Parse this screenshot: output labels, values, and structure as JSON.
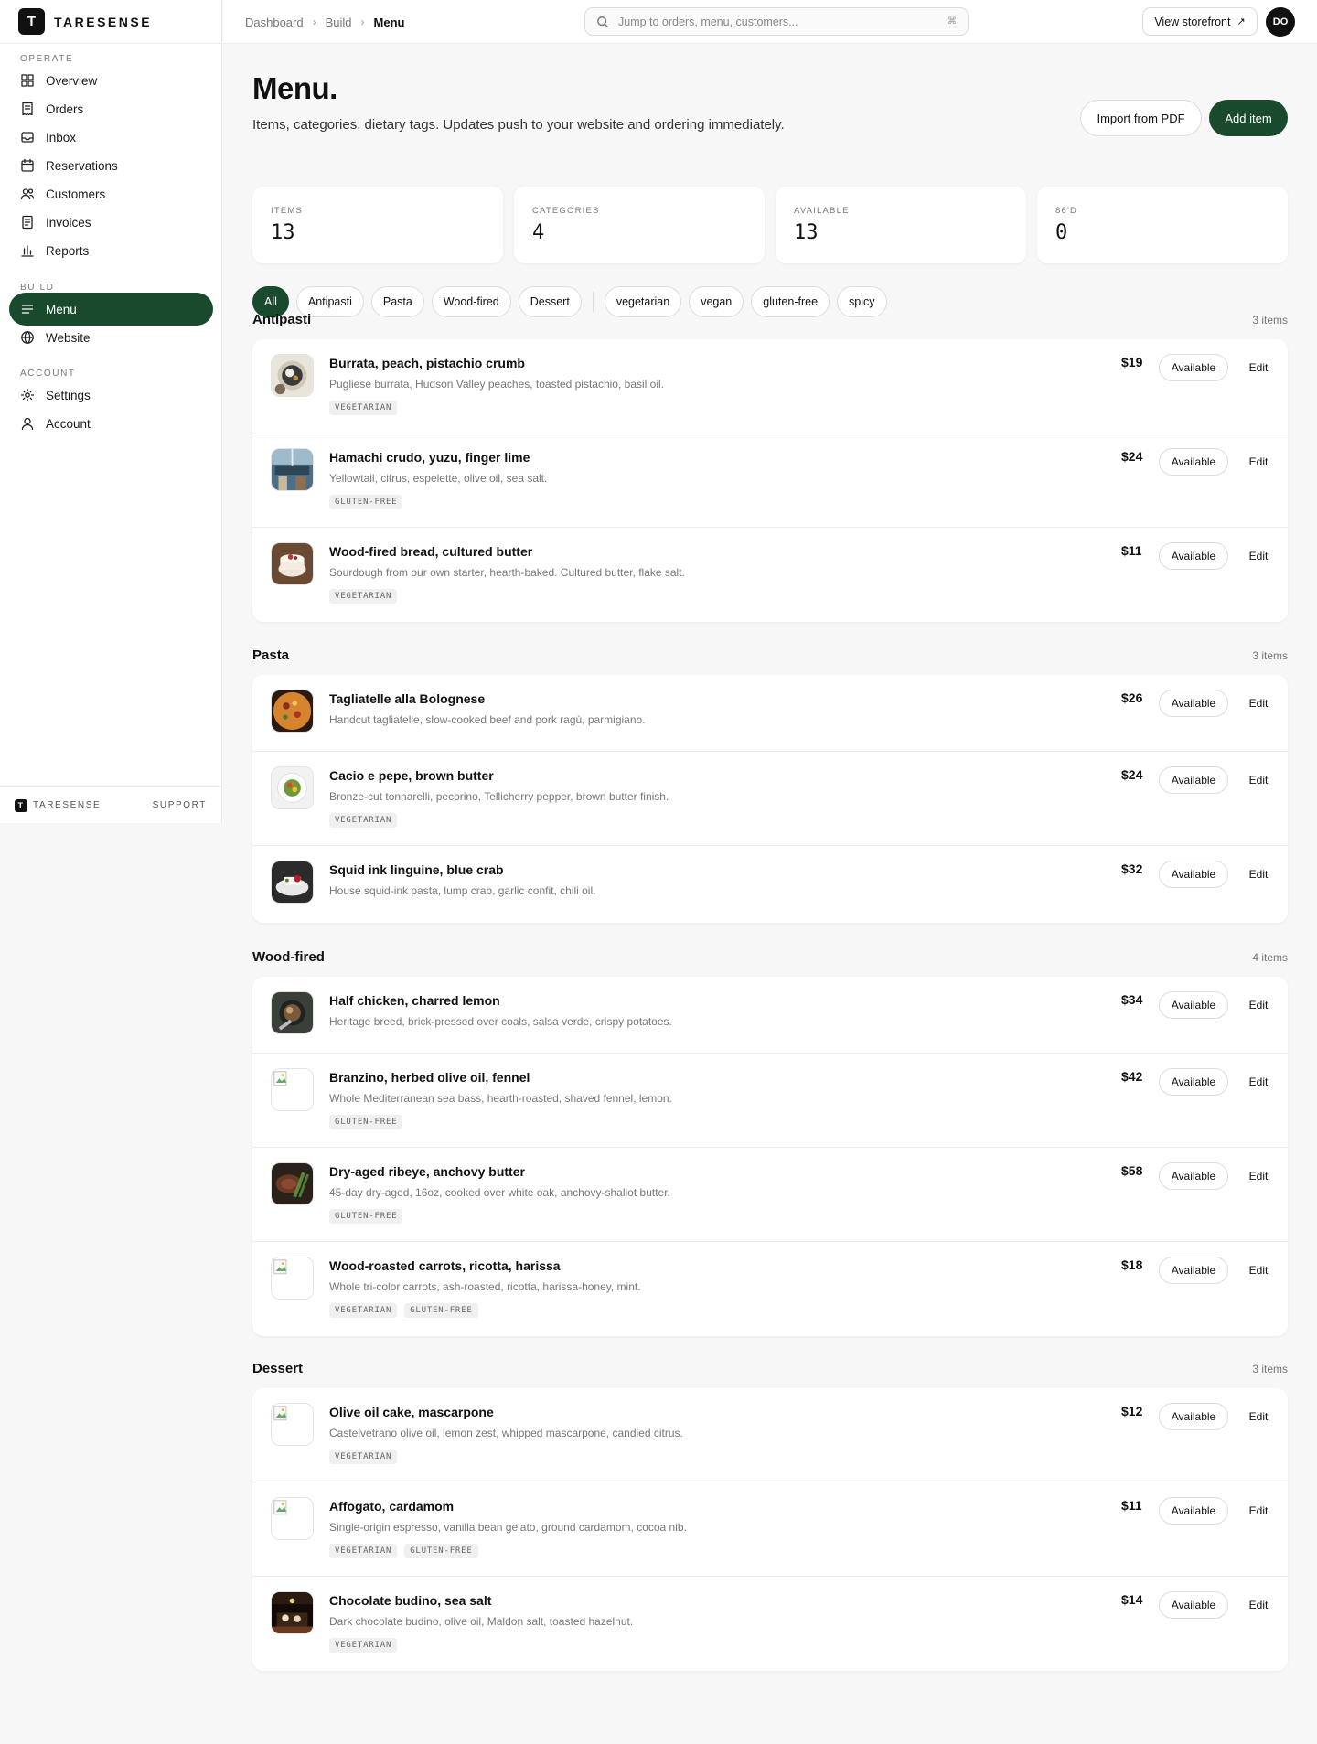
{
  "brand": {
    "name": "TARESENSE",
    "logo_letter": "T"
  },
  "sidebar": {
    "sections": [
      {
        "label": "OPERATE"
      },
      {
        "label": "BUILD"
      },
      {
        "label": "ACCOUNT"
      }
    ],
    "items": [
      {
        "label": "Overview",
        "icon": "grid-icon"
      },
      {
        "label": "Orders",
        "icon": "receipt-icon"
      },
      {
        "label": "Inbox",
        "icon": "inbox-icon"
      },
      {
        "label": "Reservations",
        "icon": "calendar-icon"
      },
      {
        "label": "Customers",
        "icon": "users-icon"
      },
      {
        "label": "Invoices",
        "icon": "invoice-icon"
      },
      {
        "label": "Reports",
        "icon": "bar-chart-icon"
      },
      {
        "label": "Menu",
        "icon": "menu-lines-icon",
        "active": true
      },
      {
        "label": "Website",
        "icon": "globe-icon"
      },
      {
        "label": "Settings",
        "icon": "settings-icon"
      },
      {
        "label": "Account",
        "icon": "user-icon"
      }
    ],
    "footer": {
      "brand": "TARESENSE",
      "support": "SUPPORT"
    }
  },
  "topbar": {
    "breadcrumbs": [
      "Dashboard",
      "Build",
      "Menu"
    ],
    "search_placeholder": "Jump to orders, menu, customers...",
    "search_kbd": "⌘",
    "storefront_label": "View storefront",
    "avatar_initials": "DO"
  },
  "page": {
    "title": "Menu.",
    "subtitle": "Items, categories, dietary tags. Updates push to your website and ordering immediately.",
    "import_label": "Import from PDF",
    "add_label": "Add item"
  },
  "stats": [
    {
      "label": "ITEMS",
      "value": "13"
    },
    {
      "label": "CATEGORIES",
      "value": "4"
    },
    {
      "label": "AVAILABLE",
      "value": "13"
    },
    {
      "label": "86'D",
      "value": "0"
    }
  ],
  "filters": {
    "categories": [
      "All",
      "Antipasti",
      "Pasta",
      "Wood-fired",
      "Dessert"
    ],
    "tags": [
      "vegetarian",
      "vegan",
      "gluten-free",
      "spicy"
    ],
    "active": "All"
  },
  "row_actions": {
    "available": "Available",
    "edit": "Edit"
  },
  "sections": [
    {
      "title": "Antipasti",
      "count": "3 items",
      "items": [
        {
          "name": "Burrata, peach, pistachio crumb",
          "desc": "Pugliese burrata, Hudson Valley peaches, toasted pistachio, basil oil.",
          "price": "$19",
          "tags": [
            "VEGETARIAN"
          ],
          "photo": "burrata"
        },
        {
          "name": "Hamachi crudo, yuzu, finger lime",
          "desc": "Yellowtail, citrus, espelette, olive oil, sea salt.",
          "price": "$24",
          "tags": [
            "GLUTEN-FREE"
          ],
          "photo": "restaurant"
        },
        {
          "name": "Wood-fired bread, cultured butter",
          "desc": "Sourdough from our own starter, hearth-baked. Cultured butter, flake salt.",
          "price": "$11",
          "tags": [
            "VEGETARIAN"
          ],
          "photo": "cake"
        }
      ]
    },
    {
      "title": "Pasta",
      "count": "3 items",
      "items": [
        {
          "name": "Tagliatelle alla Bolognese",
          "desc": "Handcut tagliatelle, slow-cooked beef and pork ragù, parmigiano.",
          "price": "$26",
          "tags": [],
          "photo": "paella"
        },
        {
          "name": "Cacio e pepe, brown butter",
          "desc": "Bronze-cut tonnarelli, pecorino, Tellicherry pepper, brown butter finish.",
          "price": "$24",
          "tags": [
            "VEGETARIAN"
          ],
          "photo": "salad"
        },
        {
          "name": "Squid ink linguine, blue crab",
          "desc": "House squid-ink pasta, lump crab, garlic confit, chili oil.",
          "price": "$32",
          "tags": [],
          "photo": "dessert-plate"
        }
      ]
    },
    {
      "title": "Wood-fired",
      "count": "4 items",
      "items": [
        {
          "name": "Half chicken, charred lemon",
          "desc": "Heritage breed, brick-pressed over coals, salsa verde, crispy potatoes.",
          "price": "$34",
          "tags": [],
          "photo": "dark-bowl"
        },
        {
          "name": "Branzino, herbed olive oil, fennel",
          "desc": "Whole Mediterranean sea bass, hearth-roasted, shaved fennel, lemon.",
          "price": "$42",
          "tags": [
            "GLUTEN-FREE"
          ],
          "photo": "broken"
        },
        {
          "name": "Dry-aged ribeye, anchovy butter",
          "desc": "45-day dry-aged, 16oz, cooked over white oak, anchovy-shallot butter.",
          "price": "$58",
          "tags": [
            "GLUTEN-FREE"
          ],
          "photo": "steak"
        },
        {
          "name": "Wood-roasted carrots, ricotta, harissa",
          "desc": "Whole tri-color carrots, ash-roasted, ricotta, harissa-honey, mint.",
          "price": "$18",
          "tags": [
            "VEGETARIAN",
            "GLUTEN-FREE"
          ],
          "photo": "broken"
        }
      ]
    },
    {
      "title": "Dessert",
      "count": "3 items",
      "items": [
        {
          "name": "Olive oil cake, mascarpone",
          "desc": "Castelvetrano olive oil, lemon zest, whipped mascarpone, candied citrus.",
          "price": "$12",
          "tags": [
            "VEGETARIAN"
          ],
          "photo": "broken"
        },
        {
          "name": "Affogato, cardamom",
          "desc": "Single-origin espresso, vanilla bean gelato, ground cardamom, cocoa nib.",
          "price": "$11",
          "tags": [
            "VEGETARIAN",
            "GLUTEN-FREE"
          ],
          "photo": "broken"
        },
        {
          "name": "Chocolate budino, sea salt",
          "desc": "Dark chocolate budino, olive oil, Maldon salt, toasted hazelnut.",
          "price": "$14",
          "tags": [
            "VEGETARIAN"
          ],
          "photo": "bar"
        }
      ]
    }
  ],
  "colors": {
    "accent": "#1a4a2e",
    "background": "#f7f7f7"
  }
}
